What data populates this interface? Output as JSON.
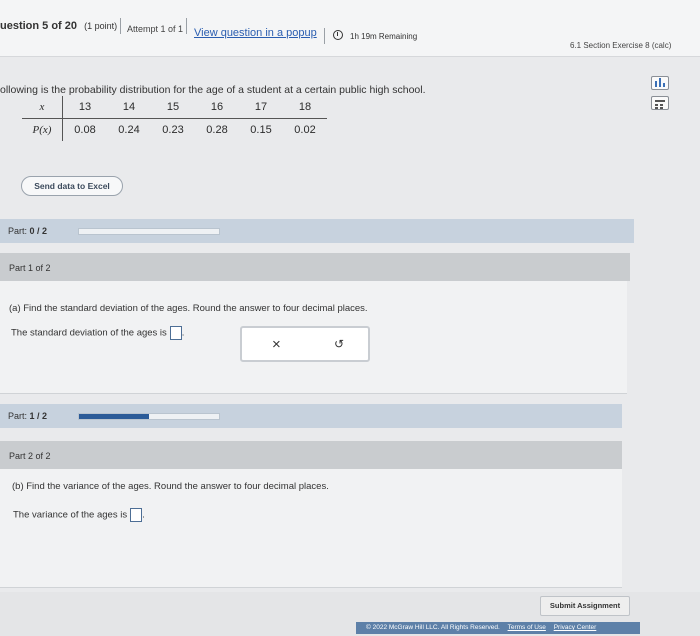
{
  "header": {
    "question_label": "uestion 5 of 20",
    "points": "(1 point)",
    "attempt": "Attempt 1 of 1",
    "popup_link": "View question in a popup",
    "time_remaining": "1h 19m Remaining",
    "section": "6.1 Section Exercise 8 (calc)"
  },
  "question": {
    "intro": "ollowing is the probability distribution for the age of a student at a certain public high school.",
    "table": {
      "row1_header": "x",
      "row2_header": "P(x)",
      "x_values": [
        "13",
        "14",
        "15",
        "16",
        "17",
        "18"
      ],
      "p_values": [
        "0.08",
        "0.24",
        "0.23",
        "0.28",
        "0.15",
        "0.02"
      ]
    },
    "excel_button": "Send data to Excel"
  },
  "parts": [
    {
      "progress_label": "Part:",
      "progress_value": "0 / 2",
      "progress_fraction": 0,
      "header": "Part 1 of 2",
      "prompt": "(a) Find the standard deviation of the ages. Round the answer to four decimal places.",
      "answer_text": "The standard deviation of the ages is"
    },
    {
      "progress_label": "Part:",
      "progress_value": "1 / 2",
      "progress_fraction": 0.5,
      "header": "Part 2 of 2",
      "prompt": "(b) Find the variance of the ages. Round the answer to four decimal places.",
      "answer_text": "The variance of the ages is"
    }
  ],
  "tools": {
    "clear": "×",
    "undo": "↺"
  },
  "footer": {
    "submit": "Submit Assignment",
    "copyright": "© 2022 McGraw Hill LLC. All Rights Reserved.",
    "terms": "Terms of Use",
    "privacy": "Privacy Center"
  },
  "colors": {
    "accent": "#2b5b98",
    "link": "#2a5db0"
  }
}
